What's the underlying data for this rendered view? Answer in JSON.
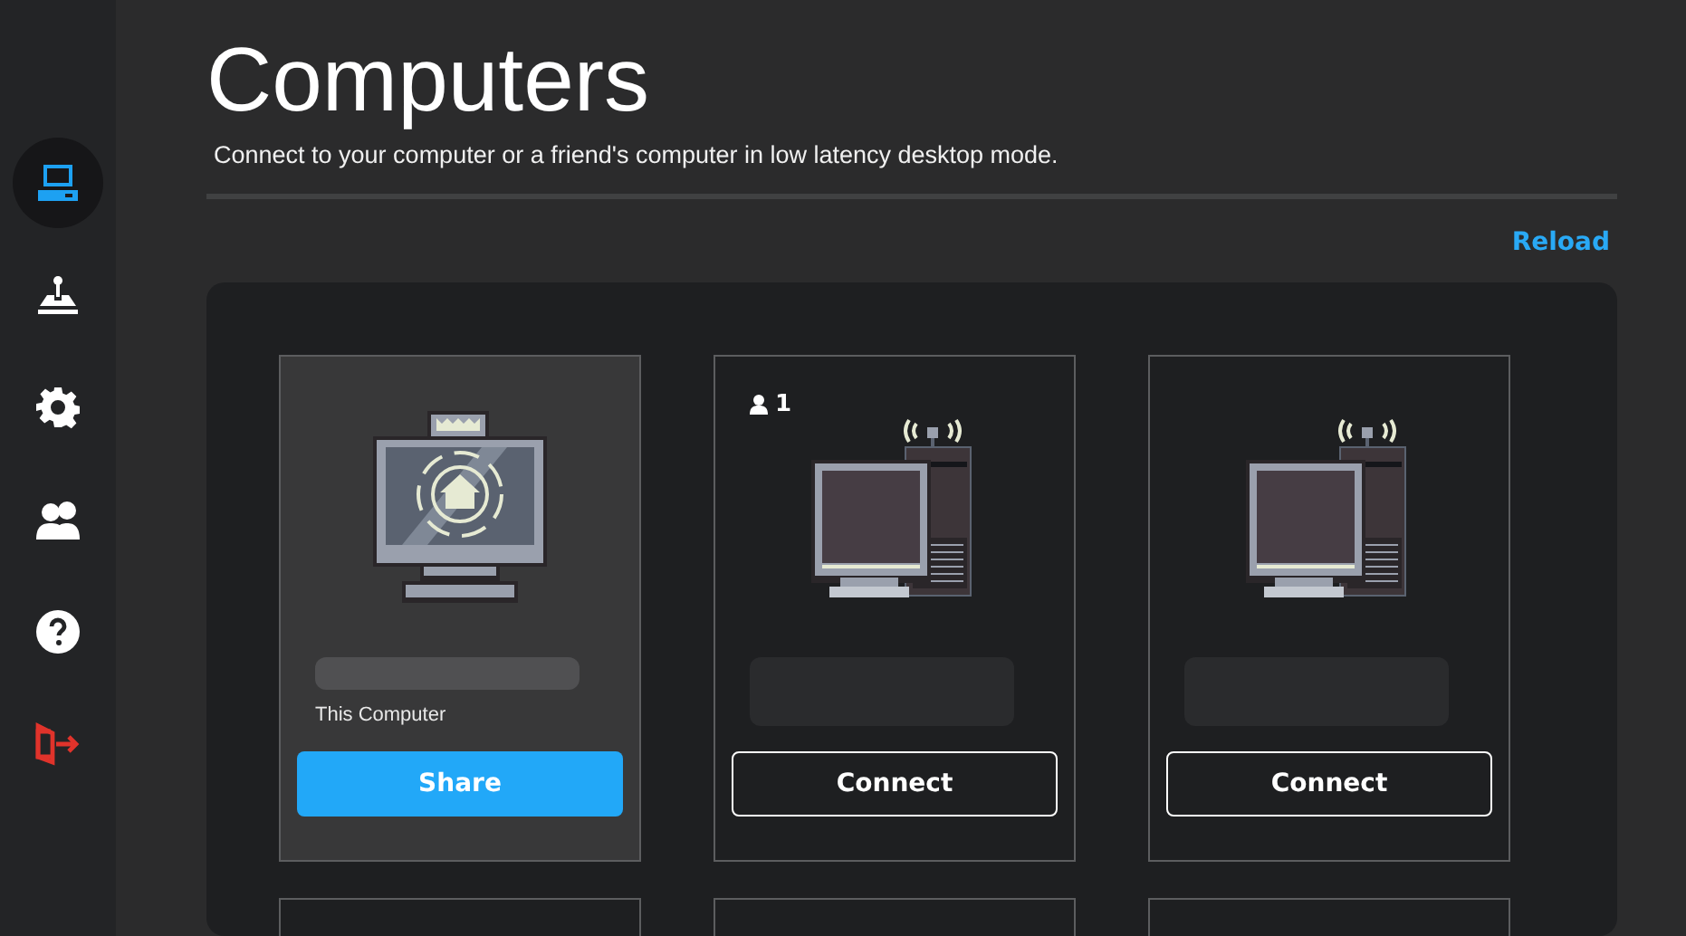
{
  "sidebar": {
    "items": [
      {
        "kind": "computers",
        "selected": true
      },
      {
        "kind": "joystick",
        "selected": false
      },
      {
        "kind": "settings",
        "selected": false
      },
      {
        "kind": "friends",
        "selected": false
      },
      {
        "kind": "help",
        "selected": false
      },
      {
        "kind": "logout",
        "selected": false
      }
    ]
  },
  "header": {
    "title": "Computers",
    "subtitle": "Connect to your computer or a friend's computer in low latency desktop mode."
  },
  "reload": "Reload",
  "cards": [
    {
      "kind": "self",
      "caption": "This Computer",
      "button": "Share"
    },
    {
      "kind": "remote",
      "users": "1",
      "button": "Connect"
    },
    {
      "kind": "remote",
      "button": "Connect"
    },
    {
      "kind": "cut"
    },
    {
      "kind": "cut"
    },
    {
      "kind": "cut"
    }
  ]
}
